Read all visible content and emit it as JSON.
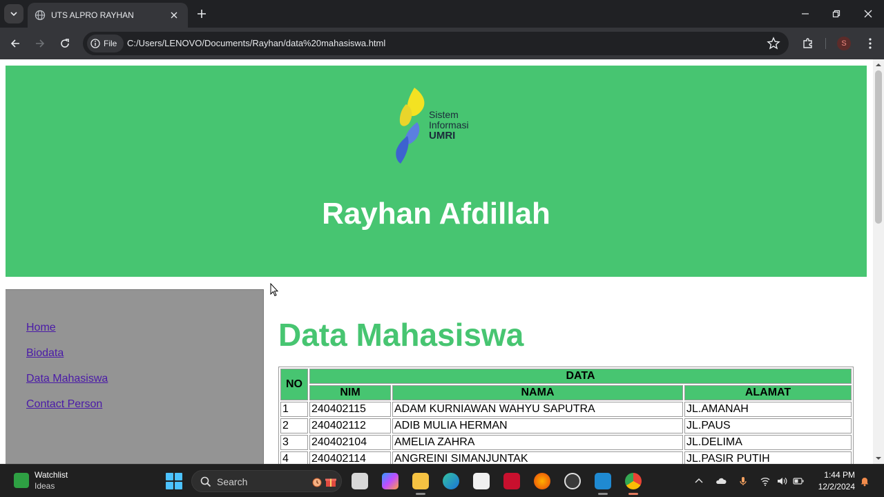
{
  "browser": {
    "tab_title": "UTS ALPRO RAYHAN",
    "chip_label": "File",
    "url": "C:/Users/LENOVO/Documents/Rayhan/data%20mahasiswa.html",
    "profile_initial": "S"
  },
  "header": {
    "logo": {
      "line1": "Sistem",
      "line2": "Informasi",
      "line3": "UMRI"
    },
    "name": "Rayhan Afdillah",
    "background_color": "#47c571"
  },
  "sidebar": {
    "links": [
      {
        "label": "Home"
      },
      {
        "label": "Biodata"
      },
      {
        "label": "Data Mahasiswa"
      },
      {
        "label": "Contact Person"
      }
    ]
  },
  "main": {
    "title": "Data Mahasiswa",
    "table": {
      "no_header": "NO",
      "group_header": "DATA",
      "columns": [
        "NIM",
        "NAMA",
        "ALAMAT"
      ],
      "rows": [
        {
          "no": "1",
          "nim": "240402115",
          "nama": "ADAM KURNIAWAN WAHYU SAPUTRA",
          "alamat": "JL.AMANAH"
        },
        {
          "no": "2",
          "nim": "240402112",
          "nama": "ADIB MULIA HERMAN",
          "alamat": "JL.PAUS"
        },
        {
          "no": "3",
          "nim": "240402104",
          "nama": "AMELIA ZAHRA",
          "alamat": "JL.DELIMA"
        },
        {
          "no": "4",
          "nim": "240402114",
          "nama": "ANGREINI SIMANJUNTAK",
          "alamat": "JL.PASIR PUTIH"
        }
      ]
    }
  },
  "taskbar": {
    "widget_title": "Watchlist",
    "widget_subtitle": "Ideas",
    "search_label": "Search",
    "time": "1:44 PM",
    "date": "12/2/2024"
  }
}
